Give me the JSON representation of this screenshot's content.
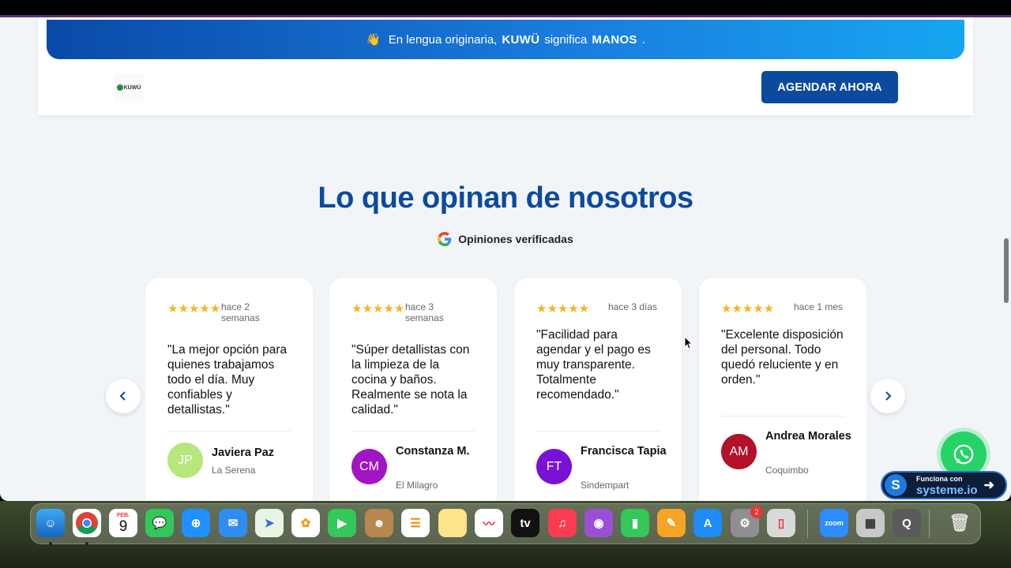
{
  "banner": {
    "prefix": "En lengua originaria,",
    "brand": "KUWÜ",
    "middle": "significa",
    "meaning": "MANOS",
    "suffix": "."
  },
  "header": {
    "logo_text": "KUWÜ",
    "cta_label": "AGENDAR AHORA"
  },
  "section": {
    "title": "Lo que opinan de nosotros",
    "verified_label": "Opiniones verificadas"
  },
  "reviews": [
    {
      "stars": "★★★★★",
      "time": "hace 2 semanas",
      "quote": "\"La mejor opción para quienes trabajamos todo el día. Muy confiables y detallistas.\"",
      "initials": "JP",
      "name": "Javiera Paz",
      "city": "La Serena",
      "color": "#b7e67a"
    },
    {
      "stars": "★★★★★",
      "time": "hace 3 semanas",
      "quote": "\"Súper detallistas con la limpieza de la cocina y baños. Realmente se nota la calidad.\"",
      "initials": "CM",
      "name": "Constanza M.",
      "city": "El Milagro",
      "color": "#a215c4"
    },
    {
      "stars": "★★★★★",
      "time": "hace 3 días",
      "quote": "\"Facilidad para agendar y el pago es muy transparente. Totalmente recomendado.\"",
      "initials": "FT",
      "name": "Francisca Tapia",
      "city": "Sindempart",
      "color": "#7a11d6"
    },
    {
      "stars": "★★★★★",
      "time": "hace 1 mes",
      "quote": "\"Excelente disposición del personal. Todo quedó reluciente y en orden.\"",
      "initials": "AM",
      "name": "Andrea Morales",
      "city": "Coquimbo",
      "color": "#b3112a"
    }
  ],
  "carousel": {
    "prev_icon": "chevron-left-icon",
    "next_icon": "chevron-right-icon"
  },
  "systeme": {
    "small": "Funciona con",
    "big": "systeme.io"
  },
  "dock": {
    "calendar_month": "FEB.",
    "calendar_day": "9",
    "settings_badge": "2",
    "zoom_label": "zoom",
    "tv_label": "tv"
  }
}
